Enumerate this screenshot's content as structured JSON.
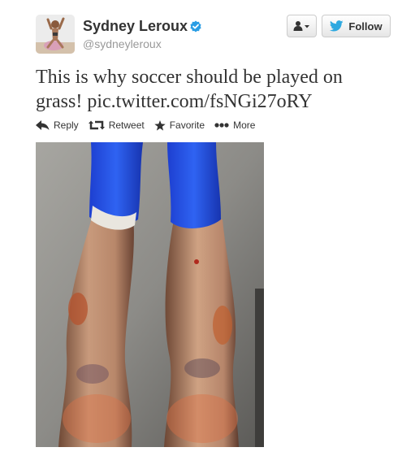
{
  "tweet": {
    "user": {
      "name": "Sydney Leroux",
      "handle": "@sydneyleroux",
      "verified": true
    },
    "text": "This is why soccer should be played on grass! pic.twitter.com/fsNGi27oRY",
    "follow_label": "Follow",
    "actions": {
      "reply": "Reply",
      "retweet": "Retweet",
      "favorite": "Favorite",
      "more": "More"
    }
  },
  "colors": {
    "twitter_blue": "#2fa9e0",
    "verified_blue": "#2a9de4",
    "text": "#333333",
    "handle_gray": "#999999"
  },
  "icons": [
    "user-icon",
    "bird-icon",
    "verified-badge-icon",
    "reply-icon",
    "retweet-icon",
    "star-icon",
    "more-icon"
  ]
}
